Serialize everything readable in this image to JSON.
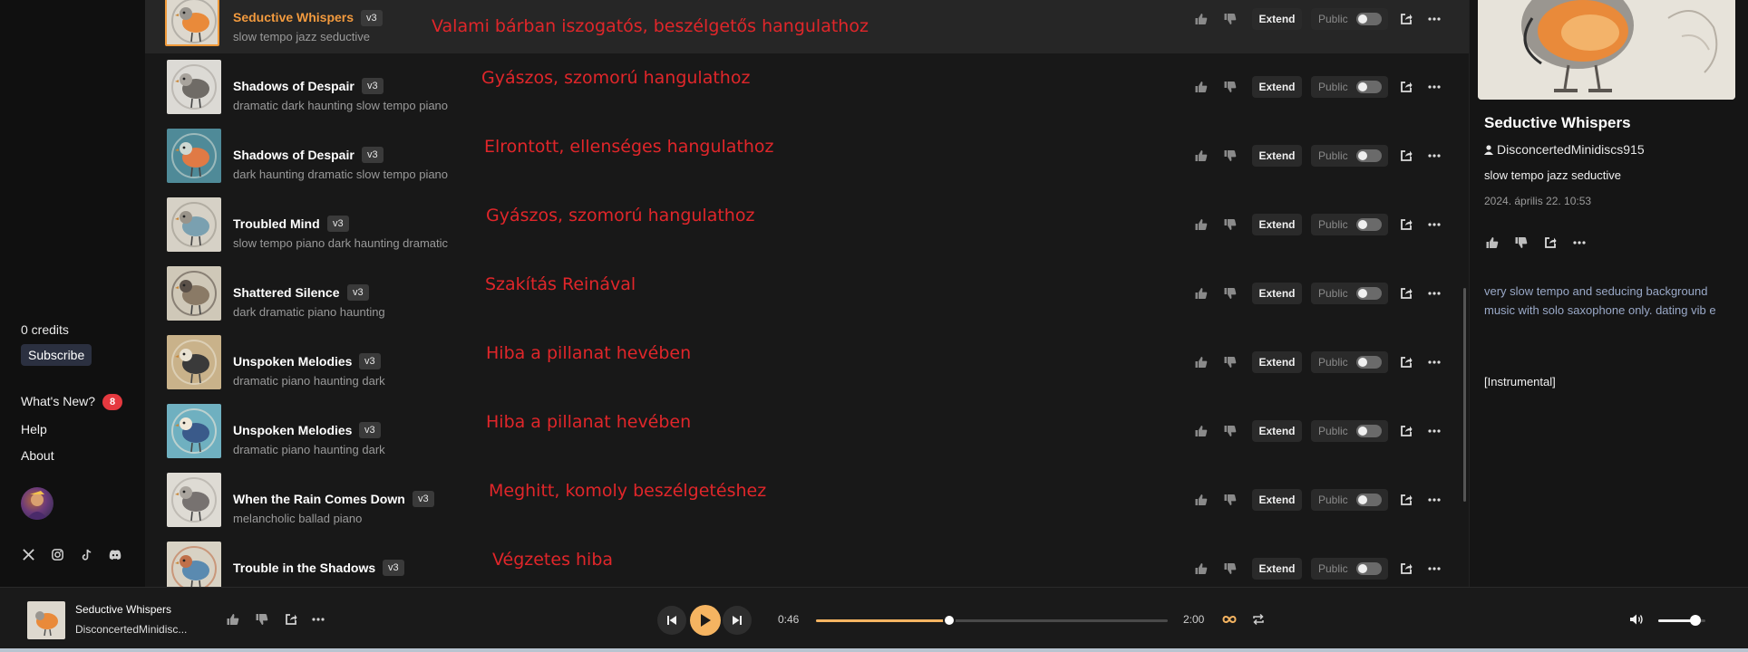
{
  "sidebar": {
    "credits": "0 credits",
    "subscribe_label": "Subscribe",
    "whats_new_label": "What's New?",
    "whats_new_badge": "8",
    "help_label": "Help",
    "about_label": "About",
    "social_icons": [
      "x-icon",
      "instagram-icon",
      "tiktok-icon",
      "discord-icon"
    ]
  },
  "list": {
    "extend_label": "Extend",
    "public_label": "Public",
    "songs": [
      {
        "title": "Seductive Whispers",
        "version": "v3",
        "tags": "slow tempo jazz seductive",
        "note": "Valami bárban iszogatós, beszélgetős hangulathoz",
        "active": true
      },
      {
        "title": "Shadows of Despair",
        "version": "v3",
        "tags": "dramatic dark haunting slow tempo piano",
        "note": "Gyászos, szomorú hangulathoz"
      },
      {
        "title": "Shadows of Despair",
        "version": "v3",
        "tags": "dark haunting dramatic slow tempo piano",
        "note": "Elrontott, ellenséges hangulathoz"
      },
      {
        "title": "Troubled Mind",
        "version": "v3",
        "tags": "slow tempo piano dark haunting dramatic",
        "note": "Gyászos, szomorú hangulathoz"
      },
      {
        "title": "Shattered Silence",
        "version": "v3",
        "tags": "dark dramatic piano haunting",
        "note": "Szakítás Reinával"
      },
      {
        "title": "Unspoken Melodies",
        "version": "v3",
        "tags": "dramatic piano haunting dark",
        "note": "Hiba a pillanat hevében"
      },
      {
        "title": "Unspoken Melodies",
        "version": "v3",
        "tags": "dramatic piano haunting dark",
        "note": "Hiba a pillanat hevében"
      },
      {
        "title": "When the Rain Comes Down",
        "version": "v3",
        "tags": "melancholic ballad piano",
        "note": "Meghitt, komoly beszélgetéshez"
      },
      {
        "title": "Trouble in the Shadows",
        "version": "v3",
        "tags": "",
        "note": "Végzetes hiba"
      }
    ]
  },
  "detail": {
    "title": "Seductive Whispers",
    "user": "DisconcertedMinidiscs915",
    "tags": "slow tempo jazz seductive",
    "date": "2024. április 22. 10:53",
    "prompt": "very slow tempo and seducing background music with solo saxophone only. dating vib e",
    "lyrics": "[Instrumental]"
  },
  "player": {
    "title": "Seductive Whispers",
    "artist": "DisconcertedMinidisc...",
    "current_time": "0:46",
    "duration": "2:00",
    "progress_fraction": 0.38,
    "volume_fraction": 0.78
  },
  "colors": {
    "accent": "#f5b461",
    "active_title": "#f29a3e",
    "annotation": "#e0262a",
    "badge": "#e5393f"
  }
}
